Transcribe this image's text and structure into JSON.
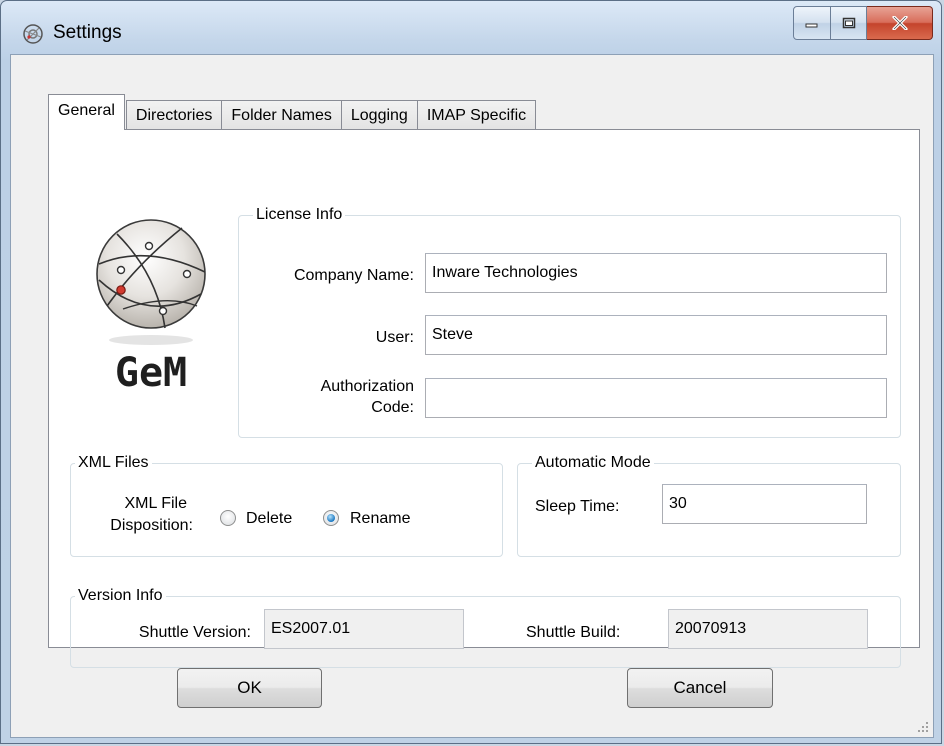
{
  "window": {
    "title": "Settings"
  },
  "tabs": [
    {
      "label": "General",
      "active": true
    },
    {
      "label": "Directories",
      "active": false
    },
    {
      "label": "Folder Names",
      "active": false
    },
    {
      "label": "Logging",
      "active": false
    },
    {
      "label": "IMAP Specific",
      "active": false
    }
  ],
  "logo": {
    "text": "GeM"
  },
  "license": {
    "group_label": "License Info",
    "company_label": "Company Name:",
    "company_value": "Inware Technologies",
    "user_label": "User:",
    "user_value": "Steve",
    "auth_label_line1": "Authorization",
    "auth_label_line2": "Code:",
    "auth_value": ""
  },
  "xml": {
    "group_label": "XML Files",
    "disposition_label_line1": "XML File",
    "disposition_label_line2": "Disposition:",
    "options": [
      {
        "label": "Delete",
        "checked": false
      },
      {
        "label": "Rename",
        "checked": true
      }
    ]
  },
  "automatic": {
    "group_label": "Automatic Mode",
    "sleep_label": "Sleep Time:",
    "sleep_value": "30"
  },
  "version": {
    "group_label": "Version Info",
    "shuttle_version_label": "Shuttle Version:",
    "shuttle_version_value": "ES2007.01",
    "shuttle_build_label": "Shuttle Build:",
    "shuttle_build_value": "20070913"
  },
  "buttons": {
    "ok": "OK",
    "cancel": "Cancel"
  },
  "colors": {
    "accent": "#1a78c2",
    "close_button": "#c4442c"
  }
}
